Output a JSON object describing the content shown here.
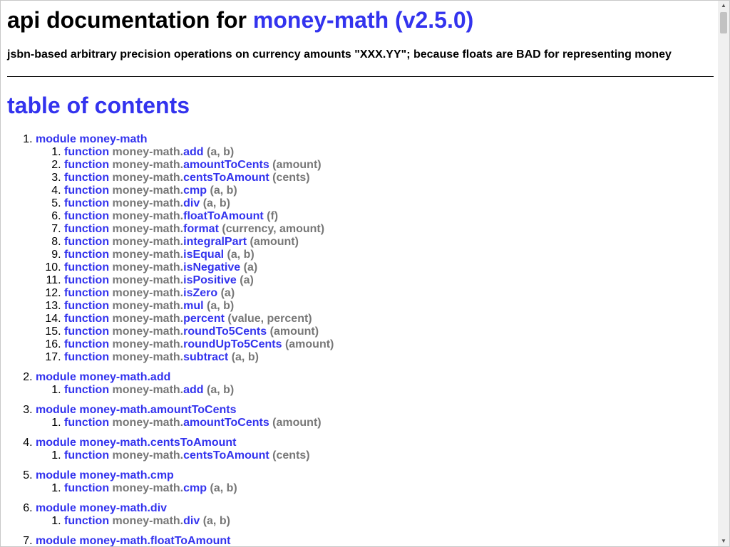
{
  "header": {
    "title_prefix": "api documentation for ",
    "title_package": "money-math (v2.5.0)",
    "subtitle": "jsbn-based arbitrary precision operations on currency amounts \"XXX.YY\"; because floats are BAD for representing money"
  },
  "toc": {
    "title": "table of contents",
    "keyword_module": "module",
    "keyword_function": "function",
    "namespace": "money-math.",
    "modules": [
      {
        "name": "money-math",
        "functions": [
          {
            "name": "add",
            "args": "(a, b)"
          },
          {
            "name": "amountToCents",
            "args": "(amount)"
          },
          {
            "name": "centsToAmount",
            "args": "(cents)"
          },
          {
            "name": "cmp",
            "args": "(a, b)"
          },
          {
            "name": "div",
            "args": "(a, b)"
          },
          {
            "name": "floatToAmount",
            "args": "(f)"
          },
          {
            "name": "format",
            "args": "(currency, amount)"
          },
          {
            "name": "integralPart",
            "args": "(amount)"
          },
          {
            "name": "isEqual",
            "args": "(a, b)"
          },
          {
            "name": "isNegative",
            "args": "(a)"
          },
          {
            "name": "isPositive",
            "args": "(a)"
          },
          {
            "name": "isZero",
            "args": "(a)"
          },
          {
            "name": "mul",
            "args": "(a, b)"
          },
          {
            "name": "percent",
            "args": "(value, percent)"
          },
          {
            "name": "roundTo5Cents",
            "args": "(amount)"
          },
          {
            "name": "roundUpTo5Cents",
            "args": "(amount)"
          },
          {
            "name": "subtract",
            "args": "(a, b)"
          }
        ]
      },
      {
        "name": "money-math.add",
        "functions": [
          {
            "name": "add",
            "args": "(a, b)"
          }
        ]
      },
      {
        "name": "money-math.amountToCents",
        "functions": [
          {
            "name": "amountToCents",
            "args": "(amount)"
          }
        ]
      },
      {
        "name": "money-math.centsToAmount",
        "functions": [
          {
            "name": "centsToAmount",
            "args": "(cents)"
          }
        ]
      },
      {
        "name": "money-math.cmp",
        "functions": [
          {
            "name": "cmp",
            "args": "(a, b)"
          }
        ]
      },
      {
        "name": "money-math.div",
        "functions": [
          {
            "name": "div",
            "args": "(a, b)"
          }
        ]
      },
      {
        "name": "money-math.floatToAmount",
        "functions": []
      }
    ]
  },
  "scrollbar": {
    "up_icon": "triangle-up",
    "down_icon": "triangle-down"
  }
}
